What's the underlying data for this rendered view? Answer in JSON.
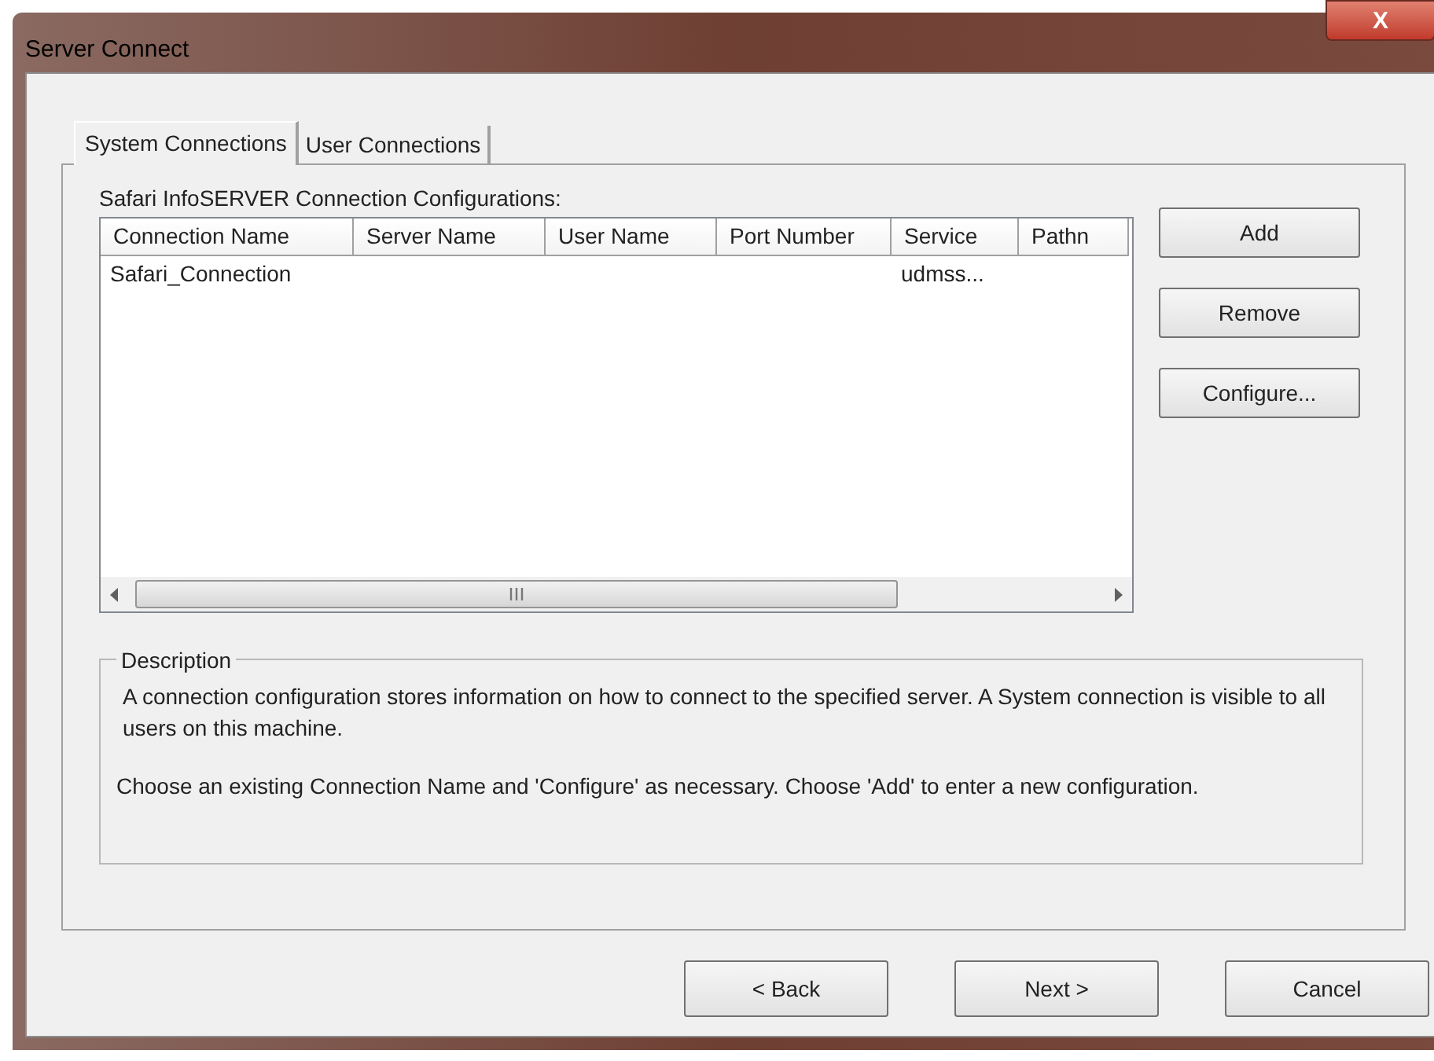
{
  "window": {
    "title": "Server Connect",
    "close": "X"
  },
  "tabs": [
    {
      "label": "System Connections",
      "selected": true
    },
    {
      "label": "User Connections",
      "selected": false
    }
  ],
  "list": {
    "label": "Safari InfoSERVER Connection Configurations:",
    "columns": [
      "Connection Name",
      "Server Name",
      "User Name",
      "Port Number",
      "Service",
      "Pathn"
    ],
    "rows": [
      [
        "Safari_Connection",
        "",
        "",
        "",
        "udmss...",
        ""
      ]
    ]
  },
  "side_buttons": [
    "Add",
    "Remove",
    "Configure..."
  ],
  "description": {
    "title": "Description",
    "paragraphs": [
      "A connection configuration stores information on how to connect to the specified server.  A System connection is visible to all users on this machine.",
      "Choose an existing Connection Name and 'Configure' as necessary.  Choose 'Add' to enter a new configuration."
    ]
  },
  "buttons": [
    "< Back",
    "Next >",
    "Cancel"
  ]
}
